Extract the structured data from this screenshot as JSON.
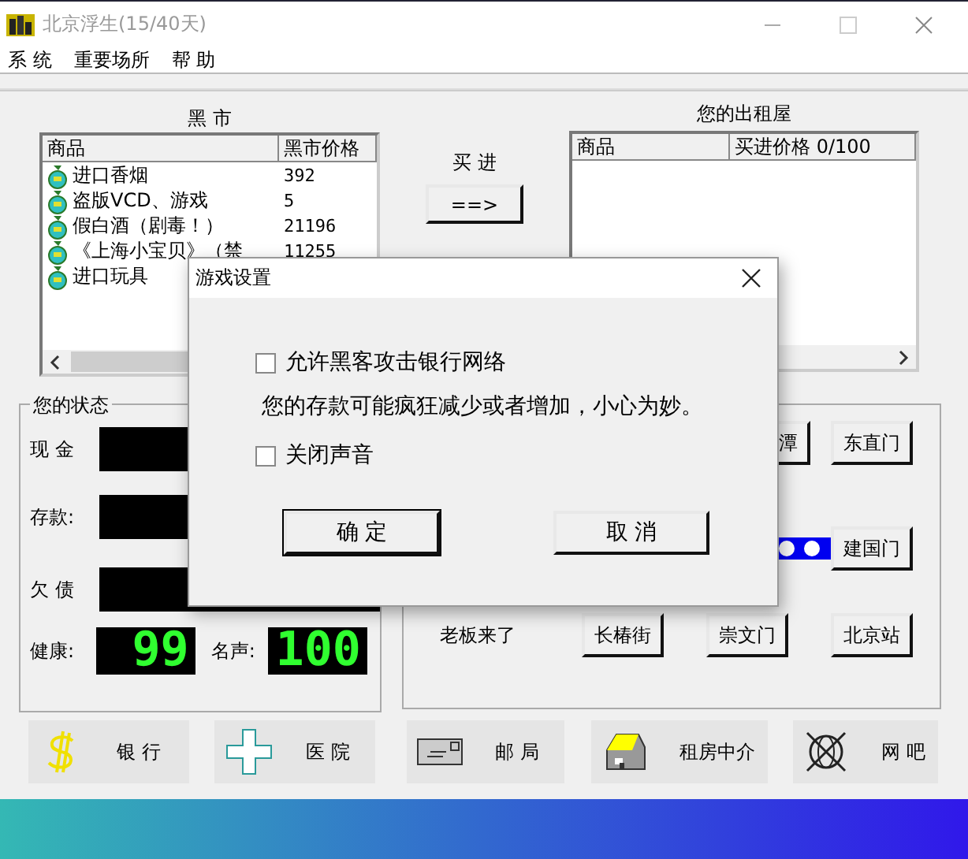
{
  "window": {
    "title": "北京浮生(15/40天)"
  },
  "menu": [
    "系 统",
    "重要场所",
    "帮 助"
  ],
  "black_market": {
    "title": "黑 市",
    "columns": [
      "商品",
      "黑市价格"
    ],
    "rows": [
      {
        "name": "进口香烟",
        "price": "392"
      },
      {
        "name": "盗版VCD、游戏",
        "price": "5"
      },
      {
        "name": "假白酒（剧毒！）",
        "price": "21196"
      },
      {
        "name": "《上海小宝贝》（禁",
        "price": "11255"
      },
      {
        "name": "进口玩具"
      }
    ]
  },
  "buy": {
    "label": "买 进",
    "button": "==>"
  },
  "rental": {
    "title": "您的出租屋",
    "columns": [
      "商品",
      "买进价格 0/100"
    ]
  },
  "status": {
    "title": "您的状态",
    "fields": [
      {
        "label": "现 金"
      },
      {
        "label": "存款:"
      },
      {
        "label": "欠 债"
      }
    ],
    "meters": [
      {
        "label": "健康:",
        "value": "99"
      },
      {
        "label": "名声:",
        "value": "100"
      }
    ]
  },
  "places": {
    "buttons": [
      "潭",
      "东直门",
      "建国门",
      "长椿街",
      "崇文门",
      "北京站"
    ],
    "note": "老板来了"
  },
  "bottom_buttons": [
    {
      "label": "银 行",
      "kind": "bank"
    },
    {
      "label": "医 院",
      "kind": "hospital"
    },
    {
      "label": "邮 局",
      "kind": "post"
    },
    {
      "label": "租房中介",
      "kind": "house"
    },
    {
      "label": "网 吧",
      "kind": "net"
    }
  ],
  "dialog": {
    "title": "游戏设置",
    "items": [
      {
        "kind": "checkbox",
        "label": "允许黑客攻击银行网络",
        "checked": false
      },
      {
        "kind": "note",
        "label": "您的存款可能疯狂减少或者增加，小心为妙。"
      },
      {
        "kind": "checkbox",
        "label": "关闭声音",
        "checked": false
      }
    ],
    "buttons": [
      "确 定",
      "取 消"
    ]
  }
}
